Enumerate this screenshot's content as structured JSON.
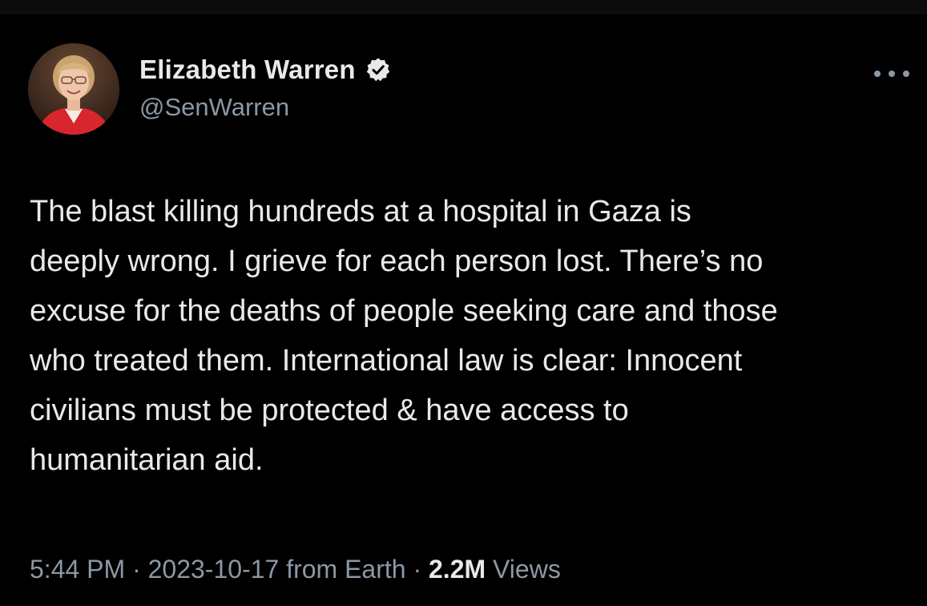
{
  "author": {
    "display_name": "Elizabeth Warren",
    "handle": "@SenWarren",
    "verified": true
  },
  "tweet": {
    "text_lines": [
      "The blast killing hundreds at a hospital in Gaza is",
      "deeply wrong. I grieve for each person lost. There’s no",
      "excuse for the deaths of people seeking care and those",
      "who treated them. International law is clear: Innocent",
      "civilians must be protected & have access to",
      "humanitarian aid."
    ]
  },
  "meta": {
    "time": "5:44 PM",
    "separator": " · ",
    "date": "2023-10-17",
    "source": "from Earth",
    "views_count": "2.2M",
    "views_label": "Views"
  },
  "icons": {
    "verified": "verified-badge-icon",
    "more": "more-options-icon"
  },
  "colors": {
    "background": "#000000",
    "primary_text": "#e7e9ea",
    "secondary_text": "#8b98a5",
    "verified_badge": "#e7e9ea"
  }
}
